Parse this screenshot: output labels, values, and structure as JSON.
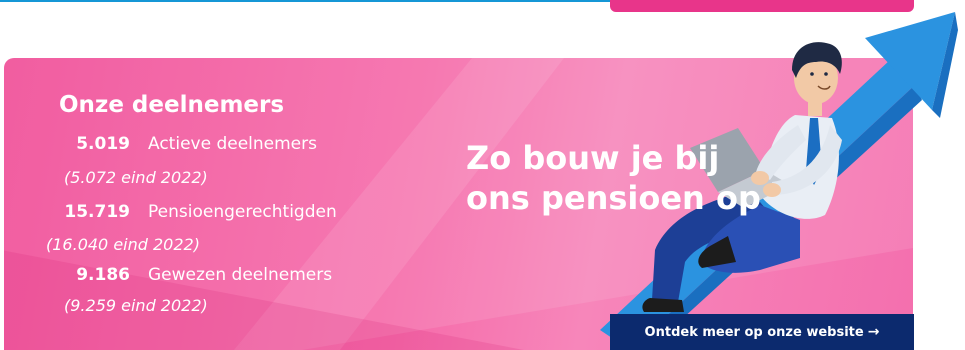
{
  "stats": {
    "title": "Onze deelnemers",
    "items": [
      {
        "value": "5.019",
        "label": "Actieve deelnemers",
        "previous": "(5.072 eind 2022)"
      },
      {
        "value": "15.719",
        "label": "Pensioengerechtigden",
        "previous": "(16.040 eind 2022)"
      },
      {
        "value": "9.186",
        "label": "Gewezen deelnemers",
        "previous": "(9.259 eind 2022)"
      }
    ]
  },
  "headline": {
    "line1": "Zo bouw je bij",
    "line2": "ons pensioen op"
  },
  "cta": {
    "label": "Ontdek meer op onze website",
    "arrow": "→"
  },
  "colors": {
    "banner_pink": "#f04b96",
    "cta_navy": "#0c2a6e",
    "accent_blue": "#1597d6",
    "top_pink": "#e8358a"
  },
  "icons": {
    "cta_arrow": "arrow-right-icon",
    "illustration": "man-on-rising-arrow-with-laptop"
  }
}
